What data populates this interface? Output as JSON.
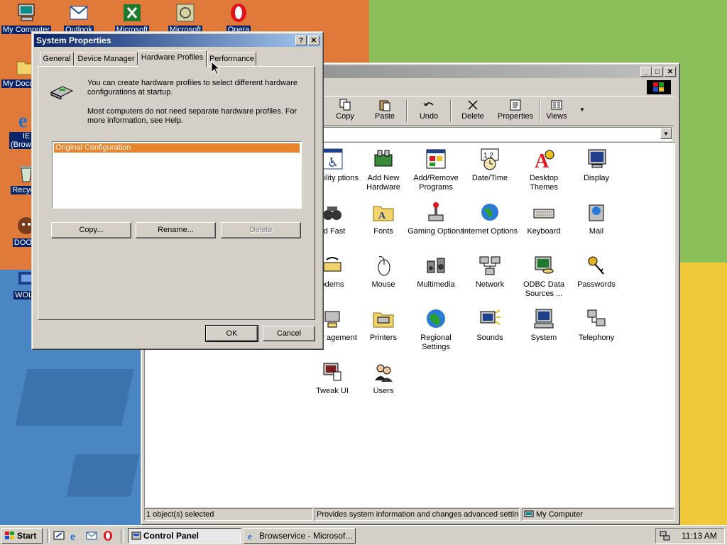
{
  "desktop": {
    "icons": [
      {
        "label": "My Computer"
      },
      {
        "label": "Outlook"
      },
      {
        "label": "Microsoft"
      },
      {
        "label": "Microsoft"
      },
      {
        "label": "Opera"
      },
      {
        "label": "My Documents"
      },
      {
        "label": "IE (Browser)"
      },
      {
        "label": "Recycle"
      },
      {
        "label": "DOOM"
      },
      {
        "label": "WOLF"
      }
    ]
  },
  "control_panel": {
    "toolbar": [
      {
        "label": "Copy",
        "icon": "copy-icon"
      },
      {
        "label": "Paste",
        "icon": "paste-icon"
      },
      {
        "label": "Undo",
        "icon": "undo-icon"
      },
      {
        "label": "Delete",
        "icon": "delete-icon"
      },
      {
        "label": "Properties",
        "icon": "properties-icon"
      },
      {
        "label": "Views",
        "icon": "views-icon"
      }
    ],
    "items": [
      {
        "label": "essibility ptions"
      },
      {
        "label": "Add New Hardware"
      },
      {
        "label": "Add/Remove Programs"
      },
      {
        "label": "Date/Time"
      },
      {
        "label": "Desktop Themes"
      },
      {
        "label": "Display"
      },
      {
        "label": "nd Fast"
      },
      {
        "label": "Fonts"
      },
      {
        "label": "Gaming Options"
      },
      {
        "label": "Internet Options"
      },
      {
        "label": "Keyboard"
      },
      {
        "label": "Mail"
      },
      {
        "label": "odems"
      },
      {
        "label": "Mouse"
      },
      {
        "label": "Multimedia"
      },
      {
        "label": "Network"
      },
      {
        "label": "ODBC Data Sources ..."
      },
      {
        "label": "Passwords"
      },
      {
        "label": "ower agement"
      },
      {
        "label": "Printers"
      },
      {
        "label": "Regional Settings"
      },
      {
        "label": "Sounds"
      },
      {
        "label": "System"
      },
      {
        "label": "Telephony"
      },
      {
        "label": "Tweak UI"
      },
      {
        "label": "Users"
      }
    ],
    "status": {
      "selected": "1 object(s) selected",
      "description": "Provides system information and changes advanced settings.",
      "location": "My Computer"
    }
  },
  "dialog": {
    "title": "System Properties",
    "help_btn": "?",
    "close_btn": "✕",
    "tabs": [
      "General",
      "Device Manager",
      "Hardware Profiles",
      "Performance"
    ],
    "active_tab": "Hardware Profiles",
    "intro1": "You can create hardware profiles to select different hardware configurations at startup.",
    "intro2": "Most computers do not need separate hardware profiles. For more information, see Help.",
    "profiles": [
      "Original Configuration"
    ],
    "copy_btn": "Copy...",
    "rename_btn": "Rename...",
    "delete_btn": "Delete",
    "ok_btn": "OK",
    "cancel_btn": "Cancel"
  },
  "taskbar": {
    "start": "Start",
    "tasks": [
      {
        "label": "Control Panel",
        "active": true
      },
      {
        "label": "Browservice - Microsof...",
        "active": false
      }
    ],
    "clock": "11:13 AM"
  },
  "colors": {
    "title_active": "#0a246a",
    "selection": "#e8842c",
    "face": "#d4d0c8"
  }
}
